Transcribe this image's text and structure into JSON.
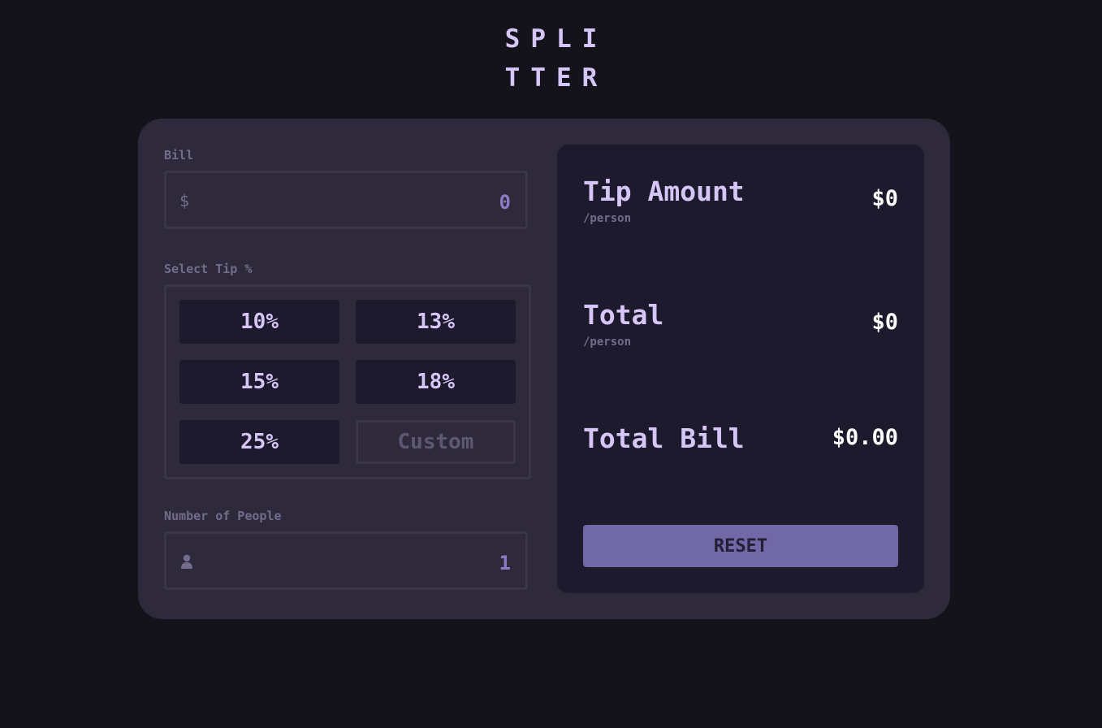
{
  "logo": {
    "line1": "SPLI",
    "line2": "TTER"
  },
  "bill": {
    "label": "Bill",
    "prefix": "$",
    "value": "0"
  },
  "tip": {
    "label": "Select Tip %",
    "options": [
      "10%",
      "13%",
      "15%",
      "18%",
      "25%"
    ],
    "custom_placeholder": "Custom"
  },
  "people": {
    "label": "Number of People",
    "icon": "person-icon",
    "value": "1"
  },
  "results": {
    "tip_amount": {
      "title": "Tip Amount",
      "sub": "/person",
      "value": "$0"
    },
    "total": {
      "title": "Total",
      "sub": "/person",
      "value": "$0"
    },
    "total_bill": {
      "title": "Total Bill",
      "value": "$0.00"
    },
    "reset_label": "RESET"
  },
  "colors": {
    "background": "#14131c",
    "card": "#2e2a3b",
    "panel": "#1e1a2e",
    "accent": "#d6c6f7",
    "reset": "#7168a8"
  }
}
